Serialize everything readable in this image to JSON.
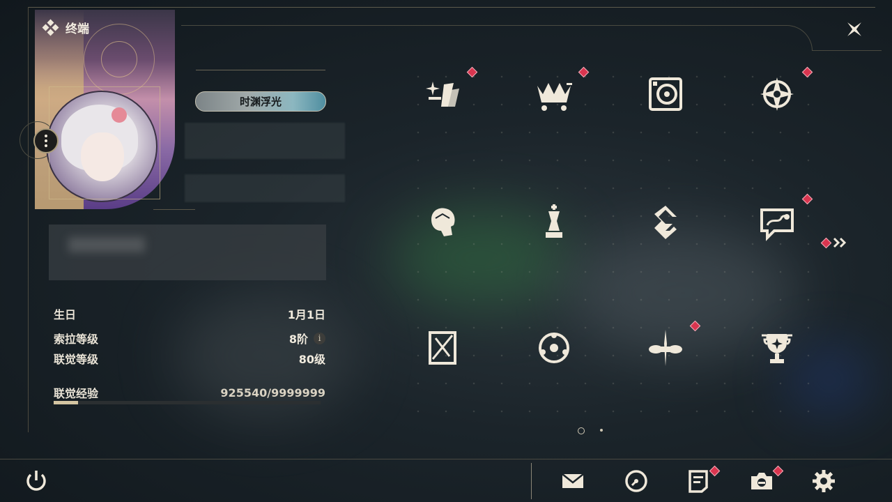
{
  "header": {
    "title": "终端"
  },
  "profile": {
    "title_badge": "时渊浮光",
    "stats": [
      {
        "label": "生日",
        "value": "1月1日"
      },
      {
        "label": "索拉等级",
        "value": "8阶"
      },
      {
        "label": "联觉等级",
        "value": "80级"
      }
    ],
    "experience": {
      "label": "联觉经验",
      "value": "925540/9999999",
      "progress": 0.0926
    }
  },
  "grid": {
    "items": [
      {
        "icon": "sparkle-icon",
        "notify": true
      },
      {
        "icon": "shop-cart-icon",
        "notify": true
      },
      {
        "icon": "record-player-icon",
        "notify": false
      },
      {
        "icon": "compass-icon",
        "notify": true
      },
      {
        "icon": "character-icon",
        "notify": false
      },
      {
        "icon": "chess-icon",
        "notify": false
      },
      {
        "icon": "guild-emblem-icon",
        "notify": false
      },
      {
        "icon": "chat-map-icon",
        "notify": true
      },
      {
        "icon": "mirror-icon",
        "notify": false
      },
      {
        "icon": "orbit-icon",
        "notify": false
      },
      {
        "icon": "vehicle-icon",
        "notify": true
      },
      {
        "icon": "trophy-icon",
        "notify": false
      }
    ],
    "page": 1,
    "pages": 2
  },
  "bottom_bar": [
    {
      "icon": "power-icon"
    },
    {
      "icon": "mail-icon"
    },
    {
      "icon": "clock-icon"
    },
    {
      "icon": "notes-icon"
    },
    {
      "icon": "camera-icon"
    },
    {
      "icon": "settings-icon"
    }
  ],
  "colors": {
    "accent": "#d4c5a2",
    "notify": "#d9354f",
    "background": "#1b242a"
  }
}
